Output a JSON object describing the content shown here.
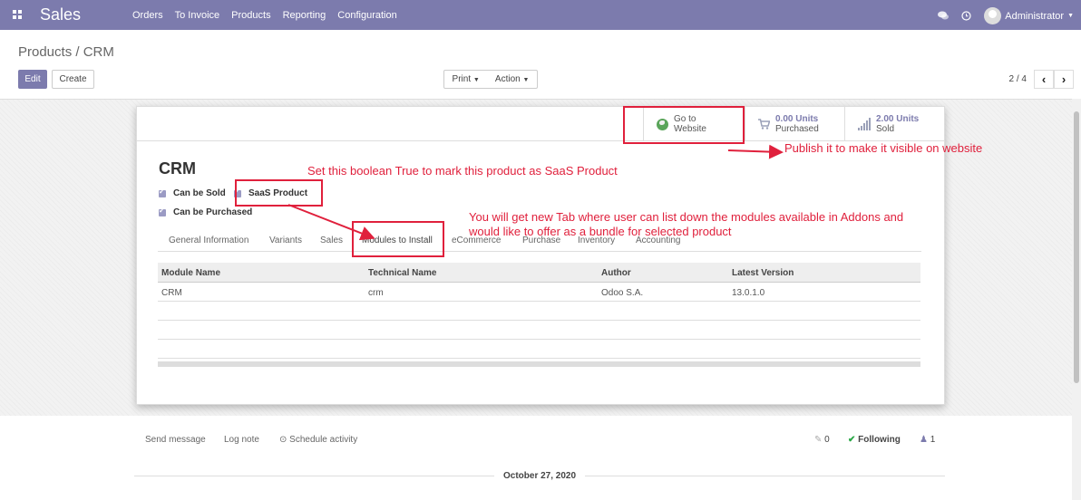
{
  "navbar": {
    "app_name": "Sales",
    "menu": [
      "Orders",
      "To Invoice",
      "Products",
      "Reporting",
      "Configuration"
    ],
    "user": "Administrator",
    "icons": [
      "apps-icon",
      "chat-icon",
      "clock-icon",
      "caret-down-icon"
    ]
  },
  "control_panel": {
    "breadcrumb": "Products / CRM",
    "edit_label": "Edit",
    "create_label": "Create",
    "print_label": "Print",
    "action_label": "Action",
    "pager": "2 / 4"
  },
  "stat_buttons": {
    "website_line1": "Go to",
    "website_line2": "Website",
    "purchased_value": "0.00 Units",
    "purchased_label": "Purchased",
    "sold_value": "2.00 Units",
    "sold_label": "Sold"
  },
  "product": {
    "name": "CRM",
    "can_be_sold": "Can be Sold",
    "saas_product": "SaaS Product",
    "can_be_purchased": "Can be Purchased"
  },
  "tabs": [
    "General Information",
    "Variants",
    "Sales",
    "Modules to Install",
    "eCommerce",
    "Purchase",
    "Inventory",
    "Accounting"
  ],
  "modules_table": {
    "headers": [
      "Module Name",
      "Technical Name",
      "Author",
      "Latest Version"
    ],
    "rows": [
      [
        "CRM",
        "crm",
        "Odoo S.A.",
        "13.0.1.0"
      ]
    ]
  },
  "annotations": {
    "publish": "Publish it to make it visible on website",
    "saas": "Set this boolean True to mark this product as SaaS Product",
    "tab_line1": "You will get new Tab where user can list down the modules available in Addons and",
    "tab_line2": "would like to offer as a bundle for selected product"
  },
  "chatter": {
    "send_message": "Send message",
    "log_note": "Log note",
    "schedule_activity": "Schedule activity",
    "attachments": "0",
    "following": "Following",
    "followers": "1",
    "date": "October 27, 2020"
  },
  "colors": {
    "brand": "#7c7bad",
    "annotation": "#e0203c"
  }
}
